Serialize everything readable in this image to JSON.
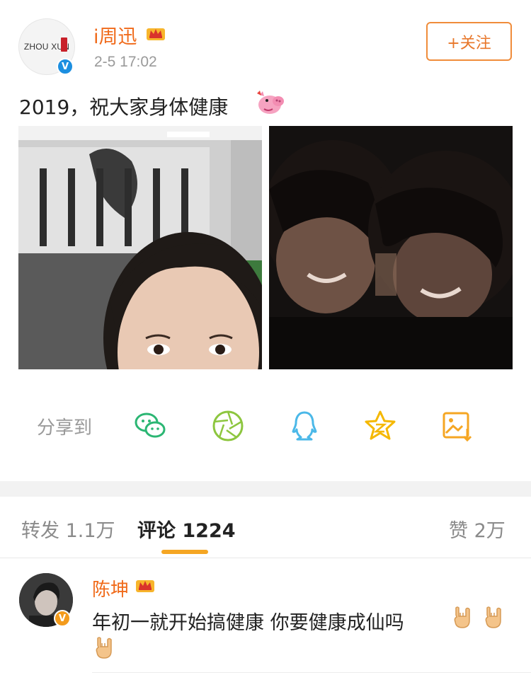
{
  "post": {
    "author": {
      "name": "i周迅",
      "avatar_text": "ZHOU XUN",
      "verified_mark": "V"
    },
    "timestamp": "2-5 17:02",
    "follow_label": "+关注",
    "text": "2019，祝大家身体健康",
    "images": [
      {
        "description_icon": "selfie-photo"
      },
      {
        "description_icon": "couple-photo"
      }
    ]
  },
  "share": {
    "label": "分享到",
    "targets": [
      {
        "icon": "wechat-icon",
        "color": "#2bb673"
      },
      {
        "icon": "moments-icon",
        "color": "#8dc63f"
      },
      {
        "icon": "qq-icon",
        "color": "#4bb8e8"
      },
      {
        "icon": "qzone-icon",
        "color": "#f5b800"
      },
      {
        "icon": "save-image-icon",
        "color": "#f5a623"
      }
    ]
  },
  "tabs": {
    "repost": "转发 1.1万",
    "comments": "评论 1224",
    "likes": "赞 2万"
  },
  "comments": [
    {
      "user": "陈坤",
      "badge": "V",
      "text": "年初一就开始搞健康 你要健康成仙吗"
    }
  ],
  "colors": {
    "accent_orange": "#f06a1a",
    "follow_border": "#f08c3a",
    "tab_underline": "#f5a623",
    "verify_blue": "#1c8fe0"
  }
}
